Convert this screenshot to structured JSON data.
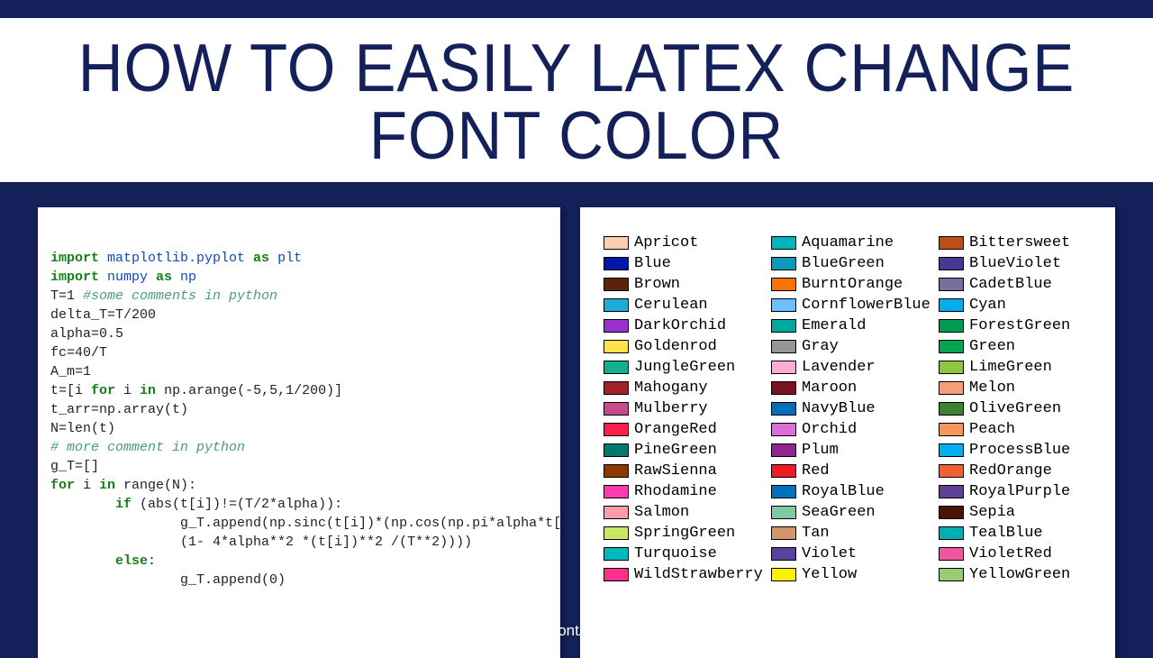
{
  "title": "How To Easily Latex Change Font Color",
  "footer": "www.FontAxis.com",
  "code": {
    "lines": [
      {
        "segments": [
          {
            "t": "import ",
            "c": "kw-green"
          },
          {
            "t": "matplotlib.pyplot ",
            "c": "kw-blue"
          },
          {
            "t": "as ",
            "c": "kw-green"
          },
          {
            "t": "plt",
            "c": "kw-blue"
          }
        ]
      },
      {
        "segments": [
          {
            "t": "import ",
            "c": "kw-green"
          },
          {
            "t": "numpy ",
            "c": "kw-blue"
          },
          {
            "t": "as ",
            "c": "kw-green"
          },
          {
            "t": "np",
            "c": "kw-blue"
          }
        ]
      },
      {
        "segments": [
          {
            "t": "",
            "c": ""
          }
        ]
      },
      {
        "segments": [
          {
            "t": "T=1 ",
            "c": ""
          },
          {
            "t": "#some comments in python",
            "c": "comment"
          }
        ]
      },
      {
        "segments": [
          {
            "t": "delta_T=T/200",
            "c": ""
          }
        ]
      },
      {
        "segments": [
          {
            "t": "alpha=0.5",
            "c": ""
          }
        ]
      },
      {
        "segments": [
          {
            "t": "fc=40/T",
            "c": ""
          }
        ]
      },
      {
        "segments": [
          {
            "t": "A_m=1",
            "c": ""
          }
        ]
      },
      {
        "segments": [
          {
            "t": "t=[i ",
            "c": ""
          },
          {
            "t": "for ",
            "c": "kw-green"
          },
          {
            "t": "i ",
            "c": ""
          },
          {
            "t": "in ",
            "c": "kw-green"
          },
          {
            "t": "np.arange(-5,5,1/200)]",
            "c": ""
          }
        ]
      },
      {
        "segments": [
          {
            "t": "t_arr=np.array(t)",
            "c": ""
          }
        ]
      },
      {
        "segments": [
          {
            "t": "N=len(t)",
            "c": ""
          }
        ]
      },
      {
        "segments": [
          {
            "t": "# more comment in python",
            "c": "comment"
          }
        ]
      },
      {
        "segments": [
          {
            "t": "g_T=[]",
            "c": ""
          }
        ]
      },
      {
        "segments": [
          {
            "t": "for ",
            "c": "kw-green"
          },
          {
            "t": "i ",
            "c": ""
          },
          {
            "t": "in ",
            "c": "kw-green"
          },
          {
            "t": "range(N):",
            "c": ""
          }
        ]
      },
      {
        "segments": [
          {
            "t": "        ",
            "c": ""
          },
          {
            "t": "if ",
            "c": "kw-green"
          },
          {
            "t": "(abs(t[i])!=(T/2*alpha)):",
            "c": ""
          }
        ]
      },
      {
        "segments": [
          {
            "t": "                g_T.append(np.sinc(t[i])*(np.cos(np.pi*alpha*t[i]/T)/",
            "c": ""
          }
        ]
      },
      {
        "segments": [
          {
            "t": "                (1- 4*alpha**2 *(t[i])**2 /(T**2))))",
            "c": ""
          }
        ]
      },
      {
        "segments": [
          {
            "t": "        ",
            "c": ""
          },
          {
            "t": "else",
            "c": "kw-green"
          },
          {
            "t": ":",
            "c": ""
          }
        ]
      },
      {
        "segments": [
          {
            "t": "                g_T.append(0)",
            "c": ""
          }
        ]
      }
    ]
  },
  "swatches": [
    {
      "name": "Apricot",
      "hex": "#fbceb1"
    },
    {
      "name": "Blue",
      "hex": "#0018a8"
    },
    {
      "name": "Brown",
      "hex": "#5b2406"
    },
    {
      "name": "Cerulean",
      "hex": "#1dacd6"
    },
    {
      "name": "DarkOrchid",
      "hex": "#9932cc"
    },
    {
      "name": "Goldenrod",
      "hex": "#ffe14a"
    },
    {
      "name": "JungleGreen",
      "hex": "#10b091"
    },
    {
      "name": "Mahogany",
      "hex": "#a1232a"
    },
    {
      "name": "Mulberry",
      "hex": "#c54b8c"
    },
    {
      "name": "OrangeRed",
      "hex": "#ff1f4f"
    },
    {
      "name": "PineGreen",
      "hex": "#01796f"
    },
    {
      "name": "RawSienna",
      "hex": "#8a3900"
    },
    {
      "name": "Rhodamine",
      "hex": "#ff3ab0"
    },
    {
      "name": "Salmon",
      "hex": "#ff9baa"
    },
    {
      "name": "SpringGreen",
      "hex": "#c7e860"
    },
    {
      "name": "Turquoise",
      "hex": "#00b7bd"
    },
    {
      "name": "WildStrawberry",
      "hex": "#ff2f92"
    },
    {
      "name": "Aquamarine",
      "hex": "#00b5be"
    },
    {
      "name": "BlueGreen",
      "hex": "#0d98ba"
    },
    {
      "name": "BurntOrange",
      "hex": "#f97301"
    },
    {
      "name": "CornflowerBlue",
      "hex": "#6bc0ff"
    },
    {
      "name": "Emerald",
      "hex": "#00a99d"
    },
    {
      "name": "Gray",
      "hex": "#939598"
    },
    {
      "name": "Lavender",
      "hex": "#fbaed2"
    },
    {
      "name": "Maroon",
      "hex": "#7a1223"
    },
    {
      "name": "NavyBlue",
      "hex": "#006eb8"
    },
    {
      "name": "Orchid",
      "hex": "#da70d6"
    },
    {
      "name": "Plum",
      "hex": "#92268f"
    },
    {
      "name": "Red",
      "hex": "#ed1b23"
    },
    {
      "name": "RoyalBlue",
      "hex": "#0071bc"
    },
    {
      "name": "SeaGreen",
      "hex": "#7fc9a3"
    },
    {
      "name": "Tan",
      "hex": "#d2966c"
    },
    {
      "name": "Violet",
      "hex": "#58429b"
    },
    {
      "name": "Yellow",
      "hex": "#fff200"
    },
    {
      "name": "Bittersweet",
      "hex": "#c04f17"
    },
    {
      "name": "BlueViolet",
      "hex": "#473992"
    },
    {
      "name": "CadetBlue",
      "hex": "#74729a"
    },
    {
      "name": "Cyan",
      "hex": "#00aeef"
    },
    {
      "name": "ForestGreen",
      "hex": "#009b55"
    },
    {
      "name": "Green",
      "hex": "#00a64f"
    },
    {
      "name": "LimeGreen",
      "hex": "#8dc73e"
    },
    {
      "name": "Melon",
      "hex": "#f89e7b"
    },
    {
      "name": "OliveGreen",
      "hex": "#3c8031"
    },
    {
      "name": "Peach",
      "hex": "#f7965a"
    },
    {
      "name": "ProcessBlue",
      "hex": "#00b0f0"
    },
    {
      "name": "RedOrange",
      "hex": "#f26035"
    },
    {
      "name": "RoyalPurple",
      "hex": "#613f99"
    },
    {
      "name": "Sepia",
      "hex": "#4a1300"
    },
    {
      "name": "TealBlue",
      "hex": "#00aeb3"
    },
    {
      "name": "VioletRed",
      "hex": "#ef58a0"
    },
    {
      "name": "YellowGreen",
      "hex": "#98cc70"
    }
  ]
}
